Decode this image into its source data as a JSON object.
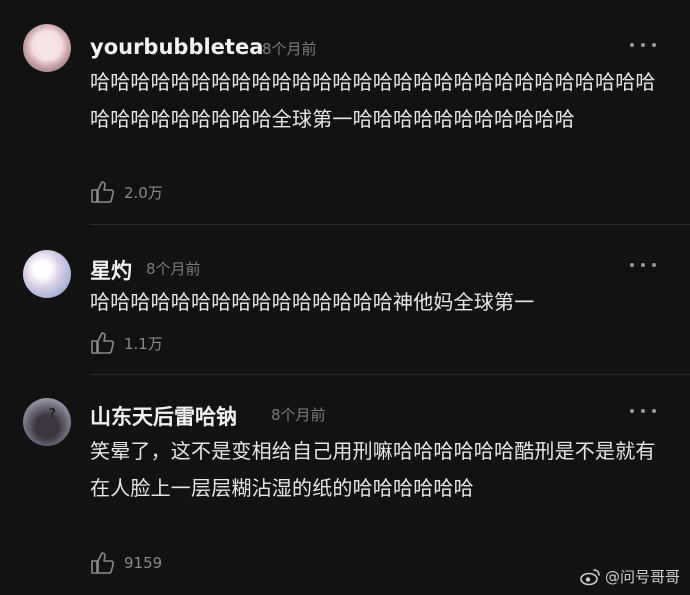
{
  "comments": [
    {
      "username": "yourbubbletea",
      "time": "8个月前",
      "text": "哈哈哈哈哈哈哈哈哈哈哈哈哈哈哈哈哈哈哈哈哈哈哈哈哈哈哈哈哈哈哈哈哈哈哈哈哈全球第一哈哈哈哈哈哈哈哈哈哈哈",
      "likes": "2.0万"
    },
    {
      "username": "星灼",
      "time": "8个月前",
      "text": "哈哈哈哈哈哈哈哈哈哈哈哈哈哈哈神他妈全球第一",
      "likes": "1.1万"
    },
    {
      "username": "山东天后雷哈钠",
      "time": "8个月前",
      "text": "笑晕了，这不是变相给自己用刑嘛哈哈哈哈哈哈酷刑是不是就有在人脸上一层层糊沾湿的纸的哈哈哈哈哈哈",
      "likes": "9159"
    }
  ],
  "watermark": {
    "text": "@问号哥哥",
    "icon": "weibo-logo-icon"
  },
  "icons": {
    "more": "more-dots-icon",
    "like": "thumbs-up-icon"
  }
}
